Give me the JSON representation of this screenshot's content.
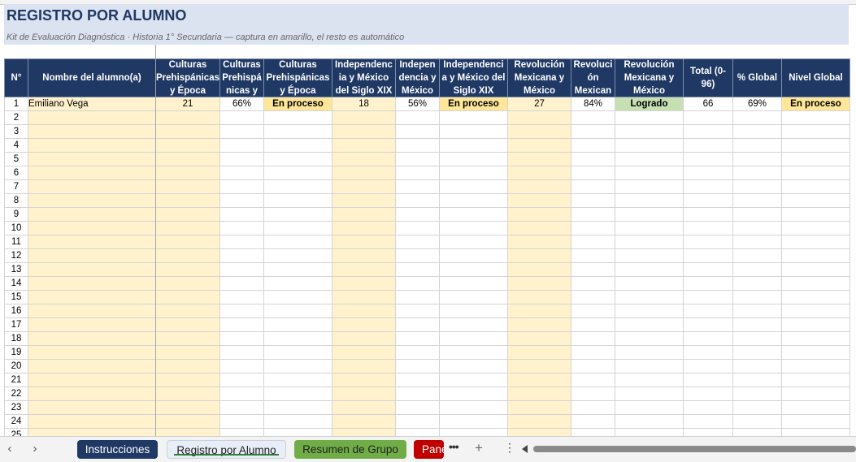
{
  "header": {
    "title": "REGISTRO POR ALUMNO",
    "subtitle": "Kit de Evaluación Diagnóstica · Historia 1° Secundaria — captura en amarillo, el resto es automático"
  },
  "columns": [
    {
      "key": "n",
      "label": "N°"
    },
    {
      "key": "name",
      "label": "Nombre del alumno(a)"
    },
    {
      "key": "c1",
      "label": "Culturas Prehispánicas y Época"
    },
    {
      "key": "c2",
      "label": "Culturas Prehispá nicas y"
    },
    {
      "key": "c3",
      "label": "Culturas Prehispánicas y Época"
    },
    {
      "key": "c4",
      "label": "Independenc ia y México del Siglo XIX"
    },
    {
      "key": "c5",
      "label": "Indepen dencia y México"
    },
    {
      "key": "c6",
      "label": "Independenci a y México del Siglo XIX"
    },
    {
      "key": "c7",
      "label": "Revolución Mexicana y México"
    },
    {
      "key": "c8",
      "label": "Revoluci ón Mexican"
    },
    {
      "key": "c9",
      "label": "Revolución Mexicana y México"
    },
    {
      "key": "total",
      "label": "Total (0-96)"
    },
    {
      "key": "pct",
      "label": "% Global"
    },
    {
      "key": "nivel",
      "label": "Nivel Global"
    }
  ],
  "rows": [
    {
      "n": "1",
      "name": "Emiliano Vega",
      "c1": "21",
      "c2": "66%",
      "c3": "En proceso",
      "c4": "18",
      "c5": "56%",
      "c6": "En proceso",
      "c7": "27",
      "c8": "84%",
      "c9": "Logrado",
      "total": "66",
      "pct": "69%",
      "nivel": "En proceso"
    },
    {
      "n": "2"
    },
    {
      "n": "3"
    },
    {
      "n": "4"
    },
    {
      "n": "5"
    },
    {
      "n": "6"
    },
    {
      "n": "7"
    },
    {
      "n": "8"
    },
    {
      "n": "9"
    },
    {
      "n": "10"
    },
    {
      "n": "11"
    },
    {
      "n": "12"
    },
    {
      "n": "13"
    },
    {
      "n": "14"
    },
    {
      "n": "15"
    },
    {
      "n": "16"
    },
    {
      "n": "17"
    },
    {
      "n": "18"
    },
    {
      "n": "19"
    },
    {
      "n": "20"
    },
    {
      "n": "21"
    },
    {
      "n": "22"
    },
    {
      "n": "23"
    },
    {
      "n": "24"
    },
    {
      "n": "25"
    }
  ],
  "level_colors": {
    "En proceso": "#ffe699",
    "Logrado": "#c6e0b4"
  },
  "tabs": {
    "prev_icon": "chevron-left",
    "next_icon": "chevron-right",
    "instrucciones": "Instrucciones",
    "registro": "Registro por Alumno",
    "resumen": "Resumen de Grupo",
    "panel": "Pane",
    "more": "•••",
    "add": "+",
    "options": "⋮"
  },
  "colors": {
    "header_bg": "#1f3864",
    "input_yellow": "#fff2cc",
    "title_band": "#dbe3f1",
    "tab_green": "#70ad47",
    "tab_red": "#c00000"
  }
}
